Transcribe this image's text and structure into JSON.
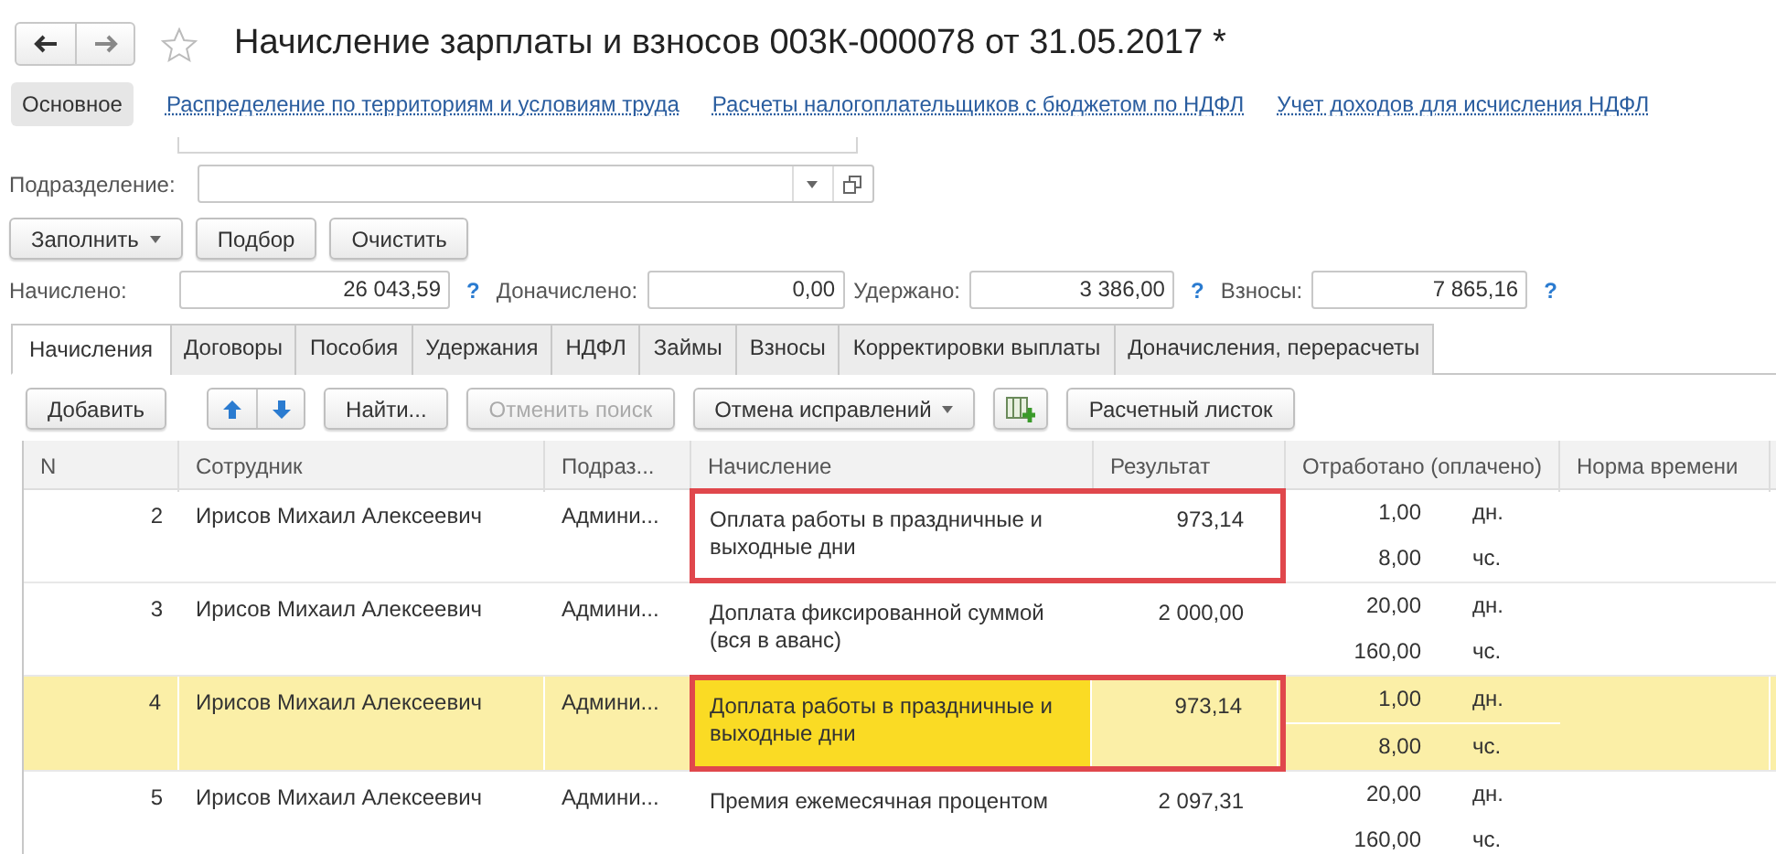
{
  "window": {
    "title": "Начисление зарплаты и взносов 003К-000078 от 31.05.2017 *"
  },
  "nav_links": [
    {
      "label": "Основное",
      "selected": true
    },
    {
      "label": "Распределение по территориям и условиям труда",
      "selected": false
    },
    {
      "label": "Расчеты налогоплательщиков с бюджетом по НДФЛ",
      "selected": false
    },
    {
      "label": "Учет доходов для исчисления НДФЛ",
      "selected": false
    }
  ],
  "subdivision": {
    "label": "Подразделение:"
  },
  "fill_buttons": [
    {
      "label": "Заполнить",
      "kind": "dropdown"
    },
    {
      "label": "Подбор",
      "kind": "plain"
    },
    {
      "label": "Очистить",
      "kind": "plain"
    }
  ],
  "totals": [
    {
      "label": "Начислено:",
      "value": "26 043,59",
      "help": "?"
    },
    {
      "label": "Доначислено:",
      "value": "0,00"
    },
    {
      "label": "Удержано:",
      "value": "3 386,00",
      "help": "?"
    },
    {
      "label": "Взносы:",
      "value": "7 865,16",
      "help": "?"
    }
  ],
  "tabs": [
    {
      "label": "Начисления",
      "selected": true
    },
    {
      "label": "Договоры",
      "selected": false
    },
    {
      "label": "Пособия",
      "selected": false
    },
    {
      "label": "Удержания",
      "selected": false
    },
    {
      "label": "НДФЛ",
      "selected": false
    },
    {
      "label": "Займы",
      "selected": false
    },
    {
      "label": "Взносы",
      "selected": false
    },
    {
      "label": "Корректировки выплаты",
      "selected": false
    },
    {
      "label": "Доначисления, перерасчеты",
      "selected": false
    }
  ],
  "toolbar": [
    {
      "kind": "button",
      "label": "Добавить",
      "disabled": false
    },
    {
      "kind": "arrows"
    },
    {
      "kind": "button",
      "label": "Найти...",
      "disabled": false
    },
    {
      "kind": "button",
      "label": "Отменить поиск",
      "disabled": true
    },
    {
      "kind": "dropdown",
      "label": "Отмена исправлений",
      "disabled": false
    },
    {
      "kind": "icon"
    },
    {
      "kind": "button",
      "label": "Расчетный листок",
      "disabled": false
    }
  ],
  "table": {
    "columns": [
      "N",
      "Сотрудник",
      "Подраз...",
      "Начисление",
      "Результат",
      "Отработано (оплачено)",
      "Норма времени"
    ],
    "rows": [
      {
        "n": "2",
        "employee": "Ирисов Михаил Алексеевич",
        "dept": "Админи...",
        "accrual": "Оплата работы в праздничные и выходные дни",
        "result": "973,14",
        "worked": [
          {
            "value": "1,00",
            "unit": "дн."
          },
          {
            "value": "8,00",
            "unit": "чс."
          }
        ],
        "selected": false,
        "highlighted": true
      },
      {
        "n": "3",
        "employee": "Ирисов Михаил Алексеевич",
        "dept": "Админи...",
        "accrual": "Доплата фиксированной суммой (вся в аванс)",
        "result": "2 000,00",
        "worked": [
          {
            "value": "20,00",
            "unit": "дн."
          },
          {
            "value": "160,00",
            "unit": "чс."
          }
        ],
        "selected": false,
        "highlighted": false
      },
      {
        "n": "4",
        "employee": "Ирисов Михаил Алексеевич",
        "dept": "Админи...",
        "accrual": "Доплата работы в праздничные и выходные дни",
        "result": "973,14",
        "worked": [
          {
            "value": "1,00",
            "unit": "дн."
          },
          {
            "value": "8,00",
            "unit": "чс."
          }
        ],
        "selected": true,
        "highlighted": true
      },
      {
        "n": "5",
        "employee": "Ирисов Михаил Алексеевич",
        "dept": "Админи...",
        "accrual": "Премия ежемесячная процентом",
        "result": "2 097,31",
        "worked": [
          {
            "value": "20,00",
            "unit": "дн."
          },
          {
            "value": "160,00",
            "unit": "чс."
          }
        ],
        "selected": false,
        "highlighted": false
      }
    ]
  }
}
